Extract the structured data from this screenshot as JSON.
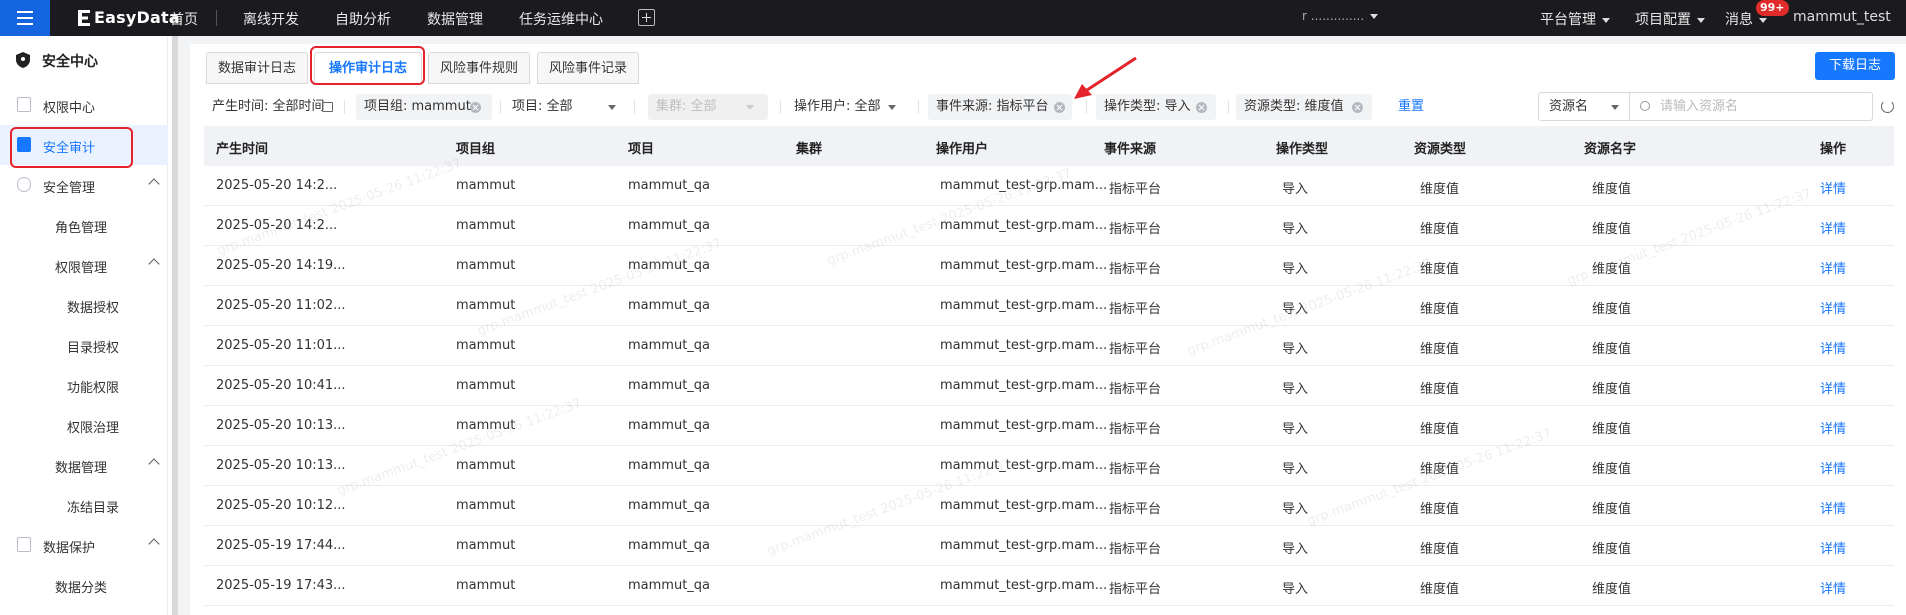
{
  "topbar": {
    "logo": "EasyData",
    "nav": [
      "首页",
      "离线开发",
      "自助分析",
      "数据管理",
      "任务运维中心"
    ],
    "right_obscured": "r ..............",
    "platform_admin": "平台管理",
    "project_config": "项目配置",
    "messages": "消息",
    "badge": "99+",
    "user": "mammut_test"
  },
  "sidebar": {
    "title": "安全中心",
    "items": [
      {
        "label": "权限中心",
        "level": 0
      },
      {
        "label": "安全审计",
        "level": 0
      },
      {
        "label": "安全管理",
        "level": 0
      },
      {
        "label": "角色管理",
        "level": 1
      },
      {
        "label": "权限管理",
        "level": 1
      },
      {
        "label": "数据授权",
        "level": 2
      },
      {
        "label": "目录授权",
        "level": 2
      },
      {
        "label": "功能权限",
        "level": 2
      },
      {
        "label": "权限治理",
        "level": 2
      },
      {
        "label": "数据管理",
        "level": 1
      },
      {
        "label": "冻结目录",
        "level": 2
      },
      {
        "label": "数据保护",
        "level": 0
      },
      {
        "label": "数据分类",
        "level": 1
      }
    ]
  },
  "tabs": [
    "数据审计日志",
    "操作审计日志",
    "风险事件规则",
    "风险事件记录"
  ],
  "download_label": "下载日志",
  "filters": {
    "time": "产生时间: 全部时间",
    "project_group": "项目组: mammut",
    "project": "项目: 全部",
    "cluster": "集群: 全部",
    "user": "操作用户: 全部",
    "event_source": "事件来源: 指标平台",
    "op_type": "操作类型: 导入",
    "resource_type": "资源类型: 维度值",
    "reset": "重置",
    "resource_select": "资源名",
    "search_placeholder": "请输入资源名"
  },
  "table": {
    "headers": [
      "产生时间",
      "项目组",
      "项目",
      "集群",
      "操作用户",
      "事件来源",
      "操作类型",
      "资源类型",
      "资源名字",
      "操作"
    ],
    "rows": [
      [
        "2025-05-20 14:2...",
        "mammut",
        "mammut_qa",
        "",
        "mammut_test-grp.mam...",
        "指标平台",
        "导入",
        "维度值",
        "维度值",
        "详情"
      ],
      [
        "2025-05-20 14:2...",
        "mammut",
        "mammut_qa",
        "",
        "mammut_test-grp.mam...",
        "指标平台",
        "导入",
        "维度值",
        "维度值",
        "详情"
      ],
      [
        "2025-05-20 14:19...",
        "mammut",
        "mammut_qa",
        "",
        "mammut_test-grp.mam...",
        "指标平台",
        "导入",
        "维度值",
        "维度值",
        "详情"
      ],
      [
        "2025-05-20 11:02...",
        "mammut",
        "mammut_qa",
        "",
        "mammut_test-grp.mam...",
        "指标平台",
        "导入",
        "维度值",
        "维度值",
        "详情"
      ],
      [
        "2025-05-20 11:01...",
        "mammut",
        "mammut_qa",
        "",
        "mammut_test-grp.mam...",
        "指标平台",
        "导入",
        "维度值",
        "维度值",
        "详情"
      ],
      [
        "2025-05-20 10:41...",
        "mammut",
        "mammut_qa",
        "",
        "mammut_test-grp.mam...",
        "指标平台",
        "导入",
        "维度值",
        "维度值",
        "详情"
      ],
      [
        "2025-05-20 10:13...",
        "mammut",
        "mammut_qa",
        "",
        "mammut_test-grp.mam...",
        "指标平台",
        "导入",
        "维度值",
        "维度值",
        "详情"
      ],
      [
        "2025-05-20 10:13...",
        "mammut",
        "mammut_qa",
        "",
        "mammut_test-grp.mam...",
        "指标平台",
        "导入",
        "维度值",
        "维度值",
        "详情"
      ],
      [
        "2025-05-20 10:12...",
        "mammut",
        "mammut_qa",
        "",
        "mammut_test-grp.mam...",
        "指标平台",
        "导入",
        "维度值",
        "维度值",
        "详情"
      ],
      [
        "2025-05-19 17:44...",
        "mammut",
        "mammut_qa",
        "",
        "mammut_test-grp.mam...",
        "指标平台",
        "导入",
        "维度值",
        "维度值",
        "详情"
      ],
      [
        "2025-05-19 17:43...",
        "mammut",
        "mammut_qa",
        "",
        "mammut_test-grp.mam...",
        "指标平台",
        "导入",
        "维度值",
        "维度值",
        "详情"
      ]
    ]
  },
  "watermark": "grp.mammut_test 2025-05-26 11:22:37",
  "colors": {
    "accent": "#1677ff",
    "highlight": "#e5232c",
    "topbar": "#1b1b1f"
  }
}
